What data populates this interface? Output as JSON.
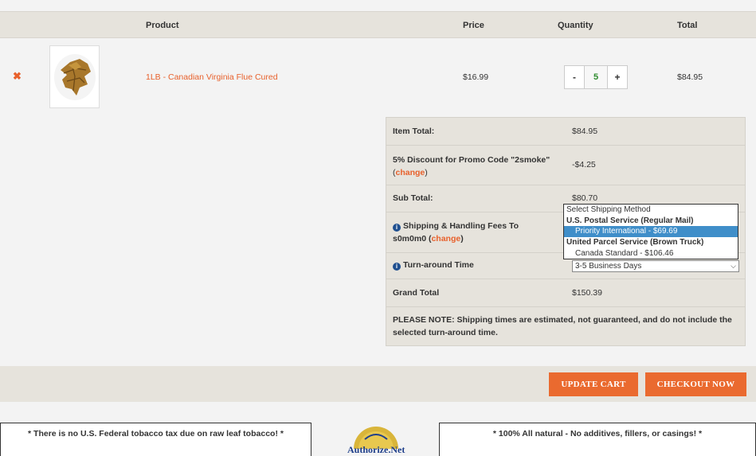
{
  "cart_header": {
    "product": "Product",
    "price": "Price",
    "quantity": "Quantity",
    "total": "Total"
  },
  "cart_item": {
    "remove_icon": "✖",
    "name": "1LB - Canadian Virginia Flue Cured",
    "price": "$16.99",
    "quantity": "5",
    "minus": "-",
    "plus": "+",
    "total": "$84.95"
  },
  "summary": {
    "item_total_label": "Item Total:",
    "item_total_value": "$84.95",
    "discount_label": "5% Discount for Promo Code \"2smoke\"",
    "discount_open": "(",
    "discount_change": "change",
    "discount_close": ")",
    "discount_value": "-$4.25",
    "subtotal_label": "Sub Total:",
    "subtotal_value": "$80.70",
    "shipping_label_line1": "Shipping & Handling Fees To",
    "shipping_label_line2": "s0m0m0 (",
    "shipping_change": "change",
    "shipping_close": ")",
    "turnaround_label": "Turn-around Time",
    "turnaround_value": "3-5 Business Days",
    "grand_total_label": "Grand Total",
    "grand_total_value": "$150.39",
    "note": "PLEASE NOTE: Shipping times are estimated, not guaranteed, and do not include the selected turn-around time."
  },
  "shipping_dropdown": {
    "placeholder": "Select Shipping Method",
    "group1": "U.S. Postal Service (Regular Mail)",
    "option1": "Priority International - $69.69",
    "group2": "United Parcel Service (Brown Truck)",
    "option2": "Canada Standard - $106.46"
  },
  "actions": {
    "update": "UPDATE CART",
    "checkout": "CHECKOUT NOW"
  },
  "footer": {
    "left_notice": "* There is no U.S. Federal tobacco tax due on raw leaf tobacco! *",
    "right_notice": "* 100% All natural - No additives, fillers, or casings! *",
    "badge_text": "Authorize.Net"
  },
  "colors": {
    "accent": "#e8612c",
    "panel": "#e6e3dc",
    "selected": "#3f8ec9"
  }
}
